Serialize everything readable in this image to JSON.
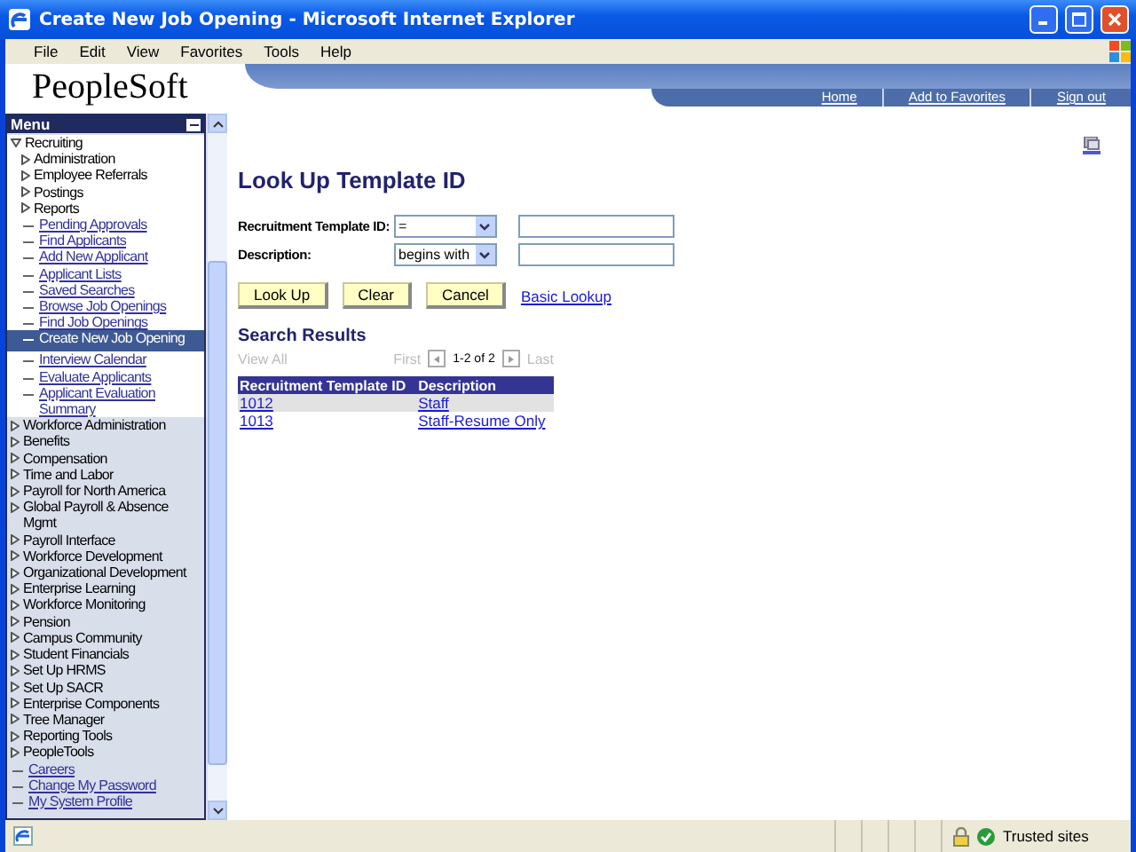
{
  "window": {
    "title": "Create New Job Opening - Microsoft Internet Explorer"
  },
  "menu_bar": [
    "File",
    "Edit",
    "View",
    "Favorites",
    "Tools",
    "Help"
  ],
  "header": {
    "logo": "PeopleSoft",
    "links": [
      "Home",
      "Add to Favorites",
      "Sign out"
    ]
  },
  "sidebar": {
    "title": "Menu",
    "items": [
      {
        "label": "Recruiting",
        "kind": "folder",
        "expanded": true,
        "children": [
          {
            "label": "Administration",
            "kind": "folder",
            "expanded": false
          },
          {
            "label": "Employee Referrals",
            "kind": "folder",
            "expanded": false
          },
          {
            "label": "Postings",
            "kind": "folder",
            "expanded": false
          },
          {
            "label": "Reports",
            "kind": "folder",
            "expanded": false
          },
          {
            "label": "Pending Approvals",
            "kind": "link",
            "selected": false
          },
          {
            "label": "Find Applicants",
            "kind": "link",
            "selected": false
          },
          {
            "label": "Add New Applicant",
            "kind": "link",
            "selected": false
          },
          {
            "label": "Applicant Lists",
            "kind": "link",
            "selected": false
          },
          {
            "label": "Saved Searches",
            "kind": "link",
            "selected": false
          },
          {
            "label": "Browse Job Openings",
            "kind": "link",
            "selected": false
          },
          {
            "label": "Find Job Openings",
            "kind": "link",
            "selected": false
          },
          {
            "label": "Create New Job Opening",
            "kind": "link",
            "selected": true
          },
          {
            "label": "Interview Calendar",
            "kind": "link",
            "selected": false
          },
          {
            "label": "Evaluate Applicants",
            "kind": "link",
            "selected": false
          },
          {
            "label": "Applicant Evaluation Summary",
            "kind": "link",
            "selected": false
          }
        ]
      },
      {
        "label": "Workforce Administration",
        "kind": "folder",
        "expanded": false
      },
      {
        "label": "Benefits",
        "kind": "folder",
        "expanded": false
      },
      {
        "label": "Compensation",
        "kind": "folder",
        "expanded": false
      },
      {
        "label": "Time and Labor",
        "kind": "folder",
        "expanded": false
      },
      {
        "label": "Payroll for North America",
        "kind": "folder",
        "expanded": false
      },
      {
        "label": "Global Payroll & Absence Mgmt",
        "kind": "folder",
        "expanded": false
      },
      {
        "label": "Payroll Interface",
        "kind": "folder",
        "expanded": false
      },
      {
        "label": "Workforce Development",
        "kind": "folder",
        "expanded": false
      },
      {
        "label": "Organizational Development",
        "kind": "folder",
        "expanded": false
      },
      {
        "label": "Enterprise Learning",
        "kind": "folder",
        "expanded": false
      },
      {
        "label": "Workforce Monitoring",
        "kind": "folder",
        "expanded": false
      },
      {
        "label": "Pension",
        "kind": "folder",
        "expanded": false
      },
      {
        "label": "Campus Community",
        "kind": "folder",
        "expanded": false
      },
      {
        "label": "Student Financials",
        "kind": "folder",
        "expanded": false
      },
      {
        "label": "Set Up HRMS",
        "kind": "folder",
        "expanded": false
      },
      {
        "label": "Set Up SACR",
        "kind": "folder",
        "expanded": false
      },
      {
        "label": "Enterprise Components",
        "kind": "folder",
        "expanded": false
      },
      {
        "label": "Tree Manager",
        "kind": "folder",
        "expanded": false
      },
      {
        "label": "Reporting Tools",
        "kind": "folder",
        "expanded": false
      },
      {
        "label": "PeopleTools",
        "kind": "folder",
        "expanded": false
      },
      {
        "label": "Careers",
        "kind": "link",
        "selected": false
      },
      {
        "label": "Change My Password",
        "kind": "link",
        "selected": false
      },
      {
        "label": "My System Profile",
        "kind": "link",
        "selected": false
      }
    ]
  },
  "lookup": {
    "title": "Look Up Template ID",
    "fields": [
      {
        "label": "Recruitment Template ID:",
        "operator": "="
      },
      {
        "label": "Description:",
        "operator": "begins with"
      }
    ],
    "buttons": [
      "Look Up",
      "Clear",
      "Cancel"
    ],
    "link": "Basic Lookup"
  },
  "results": {
    "title": "Search Results",
    "view_all": {
      "label": "View All",
      "disabled": true
    },
    "first": {
      "label": "First",
      "disabled": true
    },
    "range": "1-2 of 2",
    "last": {
      "label": "Last",
      "disabled": true
    },
    "columns": [
      "Recruitment Template ID",
      "Description"
    ],
    "rows": [
      [
        "1012",
        "Staff"
      ],
      [
        "1013",
        "Staff-Resume Only"
      ]
    ]
  },
  "status_bar": {
    "zone": "Trusted sites"
  }
}
